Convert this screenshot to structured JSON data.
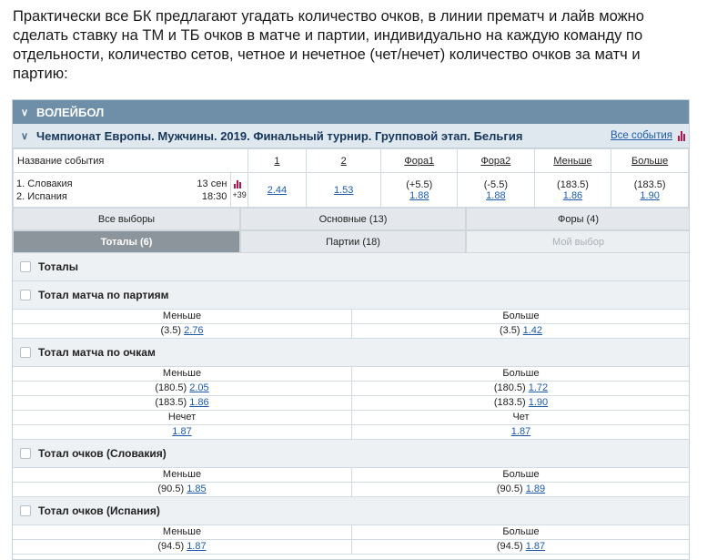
{
  "intro": "Практически все БК предлагают угадать количество очков, в линии прематч и лайв можно сделать ставку на ТМ и ТБ очков в матче и партии, индивидуально на каждую команду по отдельности, количество сетов, четное и нечетное (чет/нечет) количество очков за матч и партию:",
  "sport": "ВОЛЕЙБОЛ",
  "championship": "Чемпионат Европы. Мужчины. 2019. Финальный турнир. Групповой этап. Бельгия",
  "all_events": "Все события",
  "table": {
    "headers": [
      "Название события",
      "1",
      "2",
      "Фора1",
      "Фора2",
      "Меньше",
      "Больше"
    ],
    "team1": "1. Словакия",
    "team2": "2. Испания",
    "date": "13 сен",
    "time": "18:30",
    "more": "+39",
    "odd1": "2.44",
    "odd2": "1.53",
    "fora1_line": "(+5.5)",
    "fora1_odd": "1.88",
    "fora2_line": "(-5.5)",
    "fora2_odd": "1.88",
    "under_line": "(183.5)",
    "under_odd": "1.86",
    "over_line": "(183.5)",
    "over_odd": "1.90"
  },
  "tabs": [
    {
      "label": "Все выборы"
    },
    {
      "label": "Основные (13)"
    },
    {
      "label": "Форы (4)"
    },
    {
      "label": "Тоталы (6)"
    },
    {
      "label": "Партии (18)"
    },
    {
      "label": "Мой выбор"
    }
  ],
  "sections": {
    "totals": "Тоталы",
    "sets": {
      "title": "Тотал матча по партиям",
      "under": "Меньше",
      "over": "Больше",
      "rows": [
        {
          "l": "(3.5)",
          "lo": "2.76",
          "r": "(3.5)",
          "ro": "1.42"
        }
      ]
    },
    "points": {
      "title": "Тотал матча по очкам",
      "under": "Меньше",
      "over": "Больше",
      "rows": [
        {
          "l": "(180.5)",
          "lo": "2.05",
          "r": "(180.5)",
          "ro": "1.72"
        },
        {
          "l": "(183.5)",
          "lo": "1.86",
          "r": "(183.5)",
          "ro": "1.90"
        }
      ],
      "odd_label": "Нечет",
      "even_label": "Чет",
      "odd_value": "1.87",
      "even_value": "1.87"
    },
    "slovakia": {
      "title": "Тотал очков (Словакия)",
      "under": "Меньше",
      "over": "Больше",
      "rows": [
        {
          "l": "(90.5)",
          "lo": "1.85",
          "r": "(90.5)",
          "ro": "1.89"
        }
      ]
    },
    "spain": {
      "title": "Тотал очков (Испания)",
      "under": "Меньше",
      "over": "Больше",
      "rows": [
        {
          "l": "(94.5)",
          "lo": "1.87",
          "r": "(94.5)",
          "ro": "1.87"
        }
      ]
    }
  }
}
